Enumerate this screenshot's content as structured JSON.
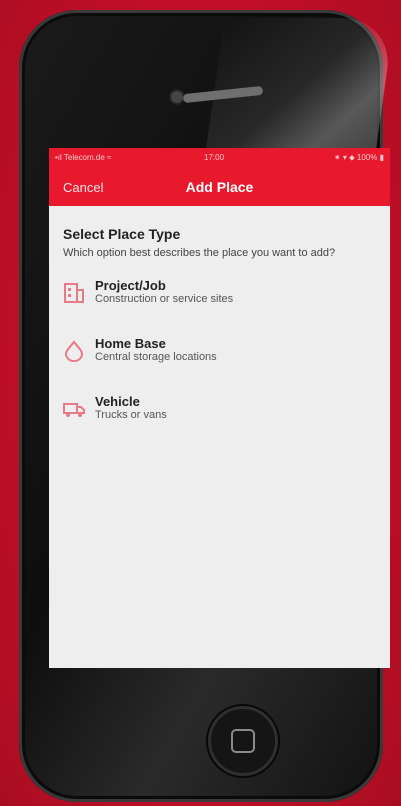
{
  "status_bar": {
    "carrier": "•ıl Telecom.de ≈",
    "time": "17:00",
    "battery": "⁕ ▾ ⬥ 100% ▮"
  },
  "nav": {
    "cancel_label": "Cancel",
    "title": "Add Place"
  },
  "section": {
    "title": "Select Place Type",
    "description": "Which option best describes the place you want to add?"
  },
  "options": [
    {
      "title": "Project/Job",
      "subtitle": "Construction or service sites",
      "icon": "building-icon"
    },
    {
      "title": "Home Base",
      "subtitle": "Central storage locations",
      "icon": "home-pin-icon"
    },
    {
      "title": "Vehicle",
      "subtitle": "Trucks or vans",
      "icon": "truck-icon"
    }
  ],
  "colors": {
    "brand_red": "#e8192c",
    "background_red": "#c8102e",
    "icon_pink": "#e87a86",
    "screen_bg": "#eeeeee"
  }
}
